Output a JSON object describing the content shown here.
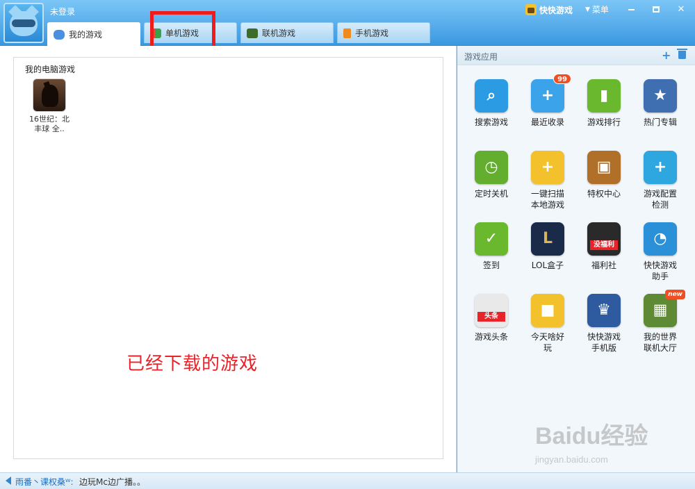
{
  "titlebar": {
    "login_text": "未登录",
    "brand": "快快游戏",
    "menu_label": "菜单"
  },
  "tabs": [
    {
      "label": "我的游戏",
      "icon": "gamepad-icon",
      "active": true
    },
    {
      "label": "单机游戏",
      "icon": "grid4-icon",
      "active": false
    },
    {
      "label": "联机游戏",
      "icon": "cube-icon",
      "active": false
    },
    {
      "label": "手机游戏",
      "icon": "phone-icon",
      "active": false
    }
  ],
  "main": {
    "section_title": "我的电脑游戏",
    "games": [
      {
        "name": "16世纪：北\n丰球 全.."
      }
    ],
    "annotation": "已经下载的游戏",
    "annotation_color": "#e8232a",
    "highlight_color": "#ee1c1c"
  },
  "side": {
    "title": "游戏应用",
    "apps": [
      {
        "label": "搜索游戏",
        "icon": "search-icon",
        "color": "#2b9be3"
      },
      {
        "label": "最近收录",
        "icon": "location-plus-icon",
        "color": "#3aa3ea",
        "badge": "99"
      },
      {
        "label": "游戏排行",
        "icon": "bar-chart-icon",
        "color": "#6ab82e"
      },
      {
        "label": "热门专辑",
        "icon": "album-icon",
        "color": "#3f6fb0"
      },
      {
        "label": "定时关机",
        "icon": "clock-icon",
        "color": "#63ad2f"
      },
      {
        "label": "一键扫描\n本地游戏",
        "icon": "folder-plus-icon",
        "color": "#f2c12c"
      },
      {
        "label": "特权中心",
        "icon": "chest-icon",
        "color": "#b0702a"
      },
      {
        "label": "游戏配置\n检测",
        "icon": "toolbox-icon",
        "color": "#2ea6e0"
      },
      {
        "label": "签到",
        "icon": "checkbox-icon",
        "color": "#6ab82e"
      },
      {
        "label": "LOL盒子",
        "icon": "lol-icon",
        "color": "#1a2b4a"
      },
      {
        "label": "福利社",
        "icon": "welfare-icon",
        "color": "#2a2a2a",
        "overlay": "没福利"
      },
      {
        "label": "快快游戏\n助手",
        "icon": "gauge-icon",
        "color": "#2a90d8"
      },
      {
        "label": "游戏头条",
        "icon": "news-icon",
        "color": "#e9e9e9",
        "overlay": "头条"
      },
      {
        "label": "今天啥好\n玩",
        "icon": "handheld-icon",
        "color": "#f2c12c"
      },
      {
        "label": "快快游戏\n手机版",
        "icon": "king-icon",
        "color": "#2e5aa0"
      },
      {
        "label": "我的世界\n联机大厅",
        "icon": "minecraft-icon",
        "color": "#5f8a35",
        "badge": "new"
      }
    ]
  },
  "statusbar": {
    "links": "雨番丶课权桑ᵂ:",
    "message": "边玩Mc边广播。。"
  },
  "watermark": {
    "logo": "Baidu经验",
    "url": "jingyan.baidu.com"
  }
}
